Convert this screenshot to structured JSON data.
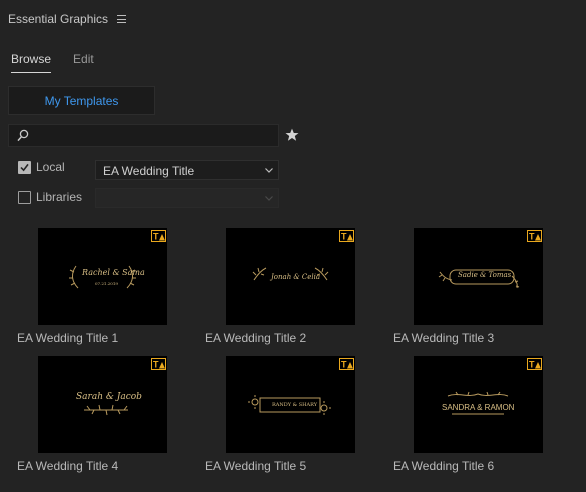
{
  "panel": {
    "title": "Essential Graphics"
  },
  "tabs": [
    {
      "label": "Browse",
      "active": true
    },
    {
      "label": "Edit",
      "active": false
    }
  ],
  "templates_button": {
    "label": "My Templates"
  },
  "search": {
    "value": "",
    "placeholder": ""
  },
  "filters": {
    "local": {
      "label": "Local",
      "checked": true,
      "selected": "EA Wedding Title"
    },
    "libraries": {
      "label": "Libraries",
      "checked": false,
      "selected": ""
    }
  },
  "tiles": [
    {
      "label": "EA Wedding Title 1",
      "names": "Rachel & Sama",
      "sub": "07.21.2019"
    },
    {
      "label": "EA Wedding Title 2",
      "names": "Jonah & Celia",
      "sub": ""
    },
    {
      "label": "EA Wedding Title 3",
      "names": "Sadie & Tomas",
      "sub": ""
    },
    {
      "label": "EA Wedding Title 4",
      "names": "Sarah & Jacob",
      "sub": ""
    },
    {
      "label": "EA Wedding Title 5",
      "names": "RANDY & SHARY",
      "sub": ""
    },
    {
      "label": "EA Wedding Title 6",
      "names": "SANDRA & RAMON",
      "sub": ""
    }
  ],
  "colors": {
    "accent": "#3f98ee",
    "gold": "#d9bf86",
    "badge": "#e9a81e"
  }
}
